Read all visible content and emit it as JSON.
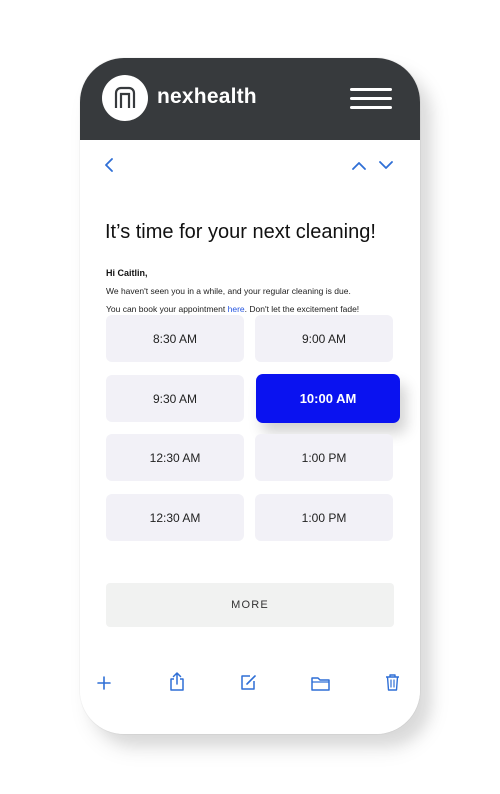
{
  "header": {
    "brand": "nexhealth",
    "logo_icon": "nexhealth-logo-icon",
    "menu_icon": "hamburger-menu-icon",
    "background": "#373a3d"
  },
  "nav": {
    "back_icon": "chevron-left-icon",
    "prev_icon": "chevron-up-icon",
    "next_icon": "chevron-down-icon"
  },
  "email": {
    "title": "It’s time for your next cleaning!",
    "greeting": "Hi Caitlin,",
    "line1": "We haven't seen you in a while, and your regular cleaning is due.",
    "line2_before": "You can book your appointment ",
    "line2_link": "here",
    "line2_after": ". Don't let the excitement fade!"
  },
  "slots": [
    {
      "label": "8:30 AM",
      "selected": false
    },
    {
      "label": "9:00 AM",
      "selected": false
    },
    {
      "label": "9:30 AM",
      "selected": false
    },
    {
      "label": "10:00 AM",
      "selected": true
    },
    {
      "label": "12:30 AM",
      "selected": false
    },
    {
      "label": "1:00 PM",
      "selected": false
    },
    {
      "label": "12:30 AM",
      "selected": false
    },
    {
      "label": "1:00 PM",
      "selected": false
    }
  ],
  "more_label": "MORE",
  "toolbar": [
    {
      "icon": "plus-icon"
    },
    {
      "icon": "share-icon"
    },
    {
      "icon": "compose-icon"
    },
    {
      "icon": "folder-icon"
    },
    {
      "icon": "trash-icon"
    }
  ],
  "colors": {
    "accent": "#0a12f0",
    "link": "#2555e0",
    "icon_blue": "#2f6fd6",
    "slot_bg": "#f2f1f7"
  }
}
